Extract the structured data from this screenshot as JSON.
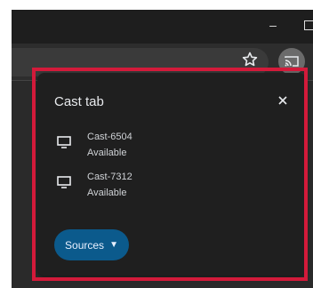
{
  "browser": {
    "minimize_symbol": "–"
  },
  "cast_popup": {
    "title": "Cast tab",
    "sinks": [
      {
        "name": "Cast-6504",
        "status": "Available",
        "icon": "monitor-icon"
      },
      {
        "name": "Cast-7312",
        "status": "Available",
        "icon": "monitor-icon"
      }
    ],
    "sources_label": "Sources",
    "sources_caret": "▼"
  },
  "colors": {
    "highlight": "#d31a3a",
    "sources_button": "#0b5a8c",
    "popup_bg": "#1f1f1f"
  }
}
